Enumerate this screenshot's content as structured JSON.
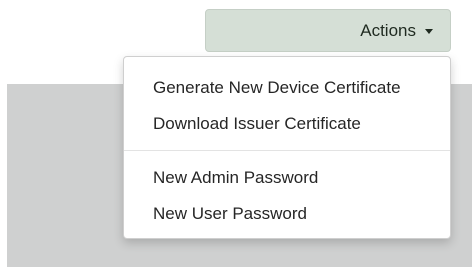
{
  "actions_button": {
    "label": "Actions",
    "icon": "caret-down-icon"
  },
  "dropdown": {
    "groups": [
      {
        "items": [
          {
            "label": "Generate New Device Certificate"
          },
          {
            "label": "Download Issuer Certificate"
          }
        ]
      },
      {
        "items": [
          {
            "label": "New Admin Password"
          },
          {
            "label": "New User Password"
          }
        ]
      }
    ]
  },
  "colors": {
    "button_background": "#d5dfd6",
    "panel_background": "#cfd0d0",
    "menu_background": "#ffffff",
    "text": "#262626"
  }
}
